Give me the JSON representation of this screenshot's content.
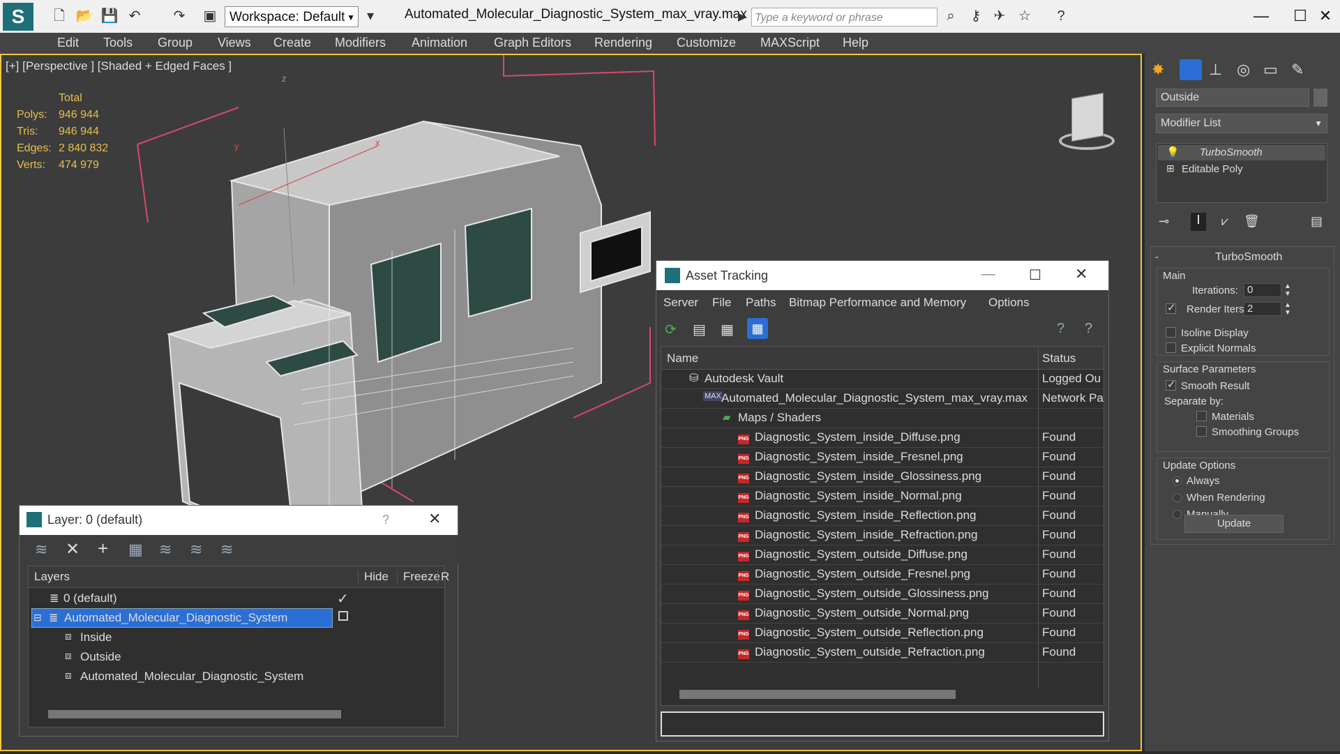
{
  "titlebar": {
    "workspace": "Workspace: Default",
    "doc_title": "Automated_Molecular_Diagnostic_System_max_vray.max",
    "search_placeholder": "Type a keyword or phrase"
  },
  "menu": [
    "Edit",
    "Tools",
    "Group",
    "Views",
    "Create",
    "Modifiers",
    "Animation",
    "Graph Editors",
    "Rendering",
    "Customize",
    "MAXScript",
    "Help"
  ],
  "viewport": {
    "label": "[+] [Perspective ] [Shaded + Edged Faces ]",
    "stats_header": "Total",
    "stats": [
      {
        "label": "Polys:",
        "value": "946 944"
      },
      {
        "label": "Tris:",
        "value": "946 944"
      },
      {
        "label": "Edges:",
        "value": "2 840 832"
      },
      {
        "label": "Verts:",
        "value": "474 979"
      }
    ],
    "axis_labels": {
      "z": "z",
      "x": "x",
      "y": "y"
    }
  },
  "cmdpanel": {
    "object_name": "Outside",
    "modifier_list": "Modifier List",
    "stack": [
      "TurboSmooth",
      "Editable Poly"
    ],
    "rollout_title": "TurboSmooth",
    "main_label": "Main",
    "iterations_label": "Iterations:",
    "iterations_value": "0",
    "render_iters_label": "Render Iters:",
    "render_iters_value": "2",
    "isoline": "Isoline Display",
    "explicit_normals": "Explicit Normals",
    "surface_params": "Surface Parameters",
    "smooth_result": "Smooth Result",
    "separate_by": "Separate by:",
    "materials": "Materials",
    "smoothing_groups": "Smoothing Groups",
    "update_options": "Update Options",
    "always": "Always",
    "when_rendering": "When Rendering",
    "manually": "Manually",
    "update_button": "Update"
  },
  "layer_window": {
    "title": "Layer: 0 (default)",
    "help": "?",
    "col_layers": "Layers",
    "col_hide": "Hide",
    "col_freeze": "Freeze",
    "col_r": "R",
    "rows": [
      {
        "name": "0 (default)"
      },
      {
        "name": "Automated_Molecular_Diagnostic_System"
      },
      {
        "name": "Inside"
      },
      {
        "name": "Outside"
      },
      {
        "name": "Automated_Molecular_Diagnostic_System"
      }
    ]
  },
  "asset_window": {
    "title": "Asset Tracking",
    "menu": [
      "Server",
      "File",
      "Paths",
      "Bitmap Performance and Memory",
      "Options"
    ],
    "col_name": "Name",
    "col_status": "Status",
    "rows": [
      {
        "name": "Autodesk Vault",
        "status": "Logged Ou"
      },
      {
        "name": "Automated_Molecular_Diagnostic_System_max_vray.max",
        "status": "Network Pa"
      },
      {
        "name": "Maps / Shaders",
        "status": ""
      },
      {
        "name": "Diagnostic_System_inside_Diffuse.png",
        "status": "Found"
      },
      {
        "name": "Diagnostic_System_inside_Fresnel.png",
        "status": "Found"
      },
      {
        "name": "Diagnostic_System_inside_Glossiness.png",
        "status": "Found"
      },
      {
        "name": "Diagnostic_System_inside_Normal.png",
        "status": "Found"
      },
      {
        "name": "Diagnostic_System_inside_Reflection.png",
        "status": "Found"
      },
      {
        "name": "Diagnostic_System_inside_Refraction.png",
        "status": "Found"
      },
      {
        "name": "Diagnostic_System_outside_Diffuse.png",
        "status": "Found"
      },
      {
        "name": "Diagnostic_System_outside_Fresnel.png",
        "status": "Found"
      },
      {
        "name": "Diagnostic_System_outside_Glossiness.png",
        "status": "Found"
      },
      {
        "name": "Diagnostic_System_outside_Normal.png",
        "status": "Found"
      },
      {
        "name": "Diagnostic_System_outside_Reflection.png",
        "status": "Found"
      },
      {
        "name": "Diagnostic_System_outside_Refraction.png",
        "status": "Found"
      }
    ]
  },
  "colors": {
    "accent": "#f5c542",
    "selection": "#2b6fd6",
    "found": "#dddddd"
  }
}
